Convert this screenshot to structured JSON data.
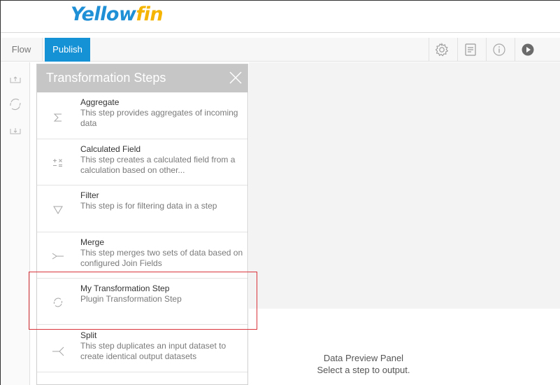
{
  "header": {
    "logo": {
      "part1": "Y",
      "part2": "ellow",
      "part3": "fin"
    }
  },
  "toolbar": {
    "tabs": [
      {
        "label": "Flow"
      },
      {
        "label": "Publish",
        "active": true
      }
    ],
    "tools": [
      "gear-icon",
      "notes-icon",
      "info-icon",
      "play-icon"
    ]
  },
  "rail": {
    "items": [
      "import-icon",
      "transform-icon",
      "export-icon"
    ]
  },
  "panel": {
    "title": "Transformation Steps",
    "steps": [
      {
        "name": "Aggregate",
        "desc": "This step provides aggregates of incoming data",
        "icon": "sigma-icon"
      },
      {
        "name": "Calculated Field",
        "desc": "This step creates a calculated field from a calculation based on other...",
        "icon": "calculator-icon"
      },
      {
        "name": "Filter",
        "desc": "This step is for filtering data in a step",
        "icon": "filter-icon"
      },
      {
        "name": "Merge",
        "desc": "This step merges two sets of data based on configured Join Fields",
        "icon": "merge-icon"
      },
      {
        "name": "My Transformation Step",
        "desc": "Plugin Transformation Step",
        "icon": "refresh-icon"
      },
      {
        "name": "Split",
        "desc": "This step duplicates an input dataset to create identical output datasets",
        "icon": "split-icon"
      }
    ]
  },
  "preview": {
    "title": "Data Preview Panel",
    "subtitle": "Select a step to output."
  },
  "colors": {
    "brand_blue": "#1592d6",
    "brand_yellow": "#f4b400",
    "highlight_red": "#d9343b",
    "panel_header": "#c6c6c6"
  }
}
